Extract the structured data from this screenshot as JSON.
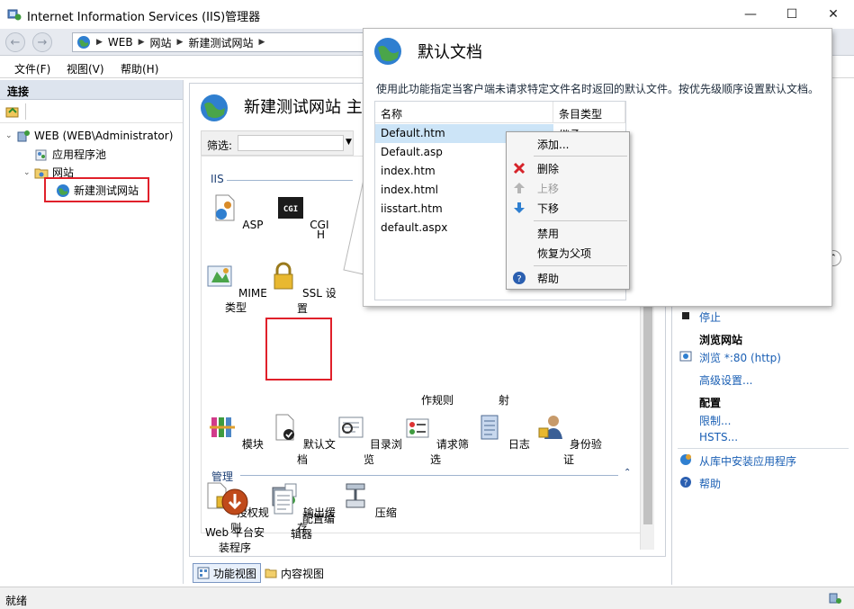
{
  "window": {
    "title": "Internet Information Services (IIS)管理器",
    "minimize": "—",
    "maximize": "☐",
    "close": "✕"
  },
  "address": {
    "crumbs": [
      "WEB",
      "网站",
      "新建测试网站"
    ],
    "sep": "▶"
  },
  "menu": {
    "file": "文件(F)",
    "view": "视图(V)",
    "help": "帮助(H)"
  },
  "connections": {
    "header": "连接",
    "tree": {
      "server": "WEB (WEB\\Administrator)",
      "app_pools": "应用程序池",
      "sites": "网站",
      "site": "新建测试网站"
    }
  },
  "center": {
    "title": "新建测试网站 主页",
    "filter_label": "筛选:",
    "group_iis": "IIS",
    "group_mgmt": "管理",
    "features": {
      "asp": "ASP",
      "cgi": "CGI",
      "h": "H",
      "mime": "MIME 类型",
      "ssl": "SSL 设置",
      "modules": "模块",
      "default_doc": "默认文档",
      "dir_browse": "目录浏览",
      "req_filter": "请求筛选",
      "logging": "日志",
      "auth": "身份验证",
      "authz": "授权规则",
      "output_cache": "输出缓存",
      "compression": "压缩",
      "web_platform": "Web 平台安\n装程序",
      "config_editor": "配置编辑器",
      "partial_a": "作规则",
      "partial_b": "射"
    },
    "cgi_glyph": "CGI"
  },
  "bottom_tabs": {
    "features_view": "功能视图",
    "content_view": "内容视图"
  },
  "actions": {
    "stop": "停止",
    "browse_head": "浏览网站",
    "browse": "浏览 *:80 (http)",
    "advanced": "高级设置...",
    "config_head": "配置",
    "limits": "限制...",
    "hsts": "HSTS...",
    "install_gallery": "从库中安装应用程序",
    "help": "帮助"
  },
  "status": {
    "text": "就绪"
  },
  "callout": {
    "title": "默认文档",
    "description": "使用此功能指定当客户端未请求特定文件名时返回的默认文件。按优先级顺序设置默认文档。",
    "col_name": "名称",
    "col_type": "条目类型",
    "first_type": "继承",
    "files": [
      "Default.htm",
      "Default.asp",
      "index.htm",
      "index.html",
      "iisstart.htm",
      "default.aspx"
    ]
  },
  "context_menu": {
    "add": "添加...",
    "delete": "删除",
    "move_up": "上移",
    "move_down": "下移",
    "disable": "禁用",
    "revert": "恢复为父项",
    "help": "帮助"
  },
  "colors": {
    "accent": "#1a5fb4",
    "highlight_box": "#e0202a",
    "selection": "#cce4f7"
  }
}
